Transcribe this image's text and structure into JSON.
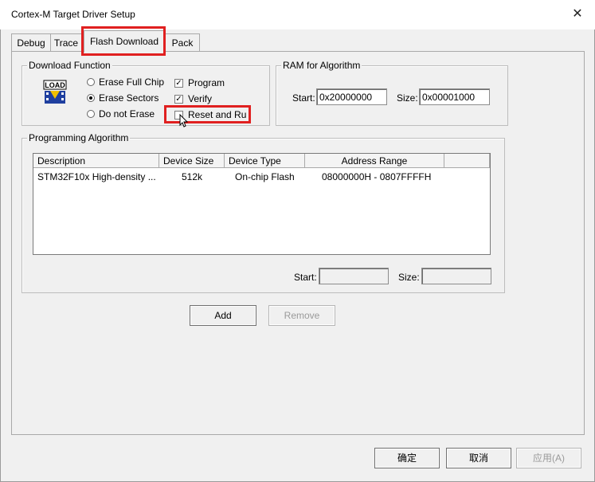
{
  "window": {
    "title": "Cortex-M Target Driver Setup",
    "close_glyph": "✕"
  },
  "tabs": [
    {
      "label": "Debug",
      "active": false
    },
    {
      "label": "Trace",
      "active": false
    },
    {
      "label": "Flash Download",
      "active": true
    },
    {
      "label": "Pack",
      "active": false
    }
  ],
  "download_function": {
    "legend": "Download Function",
    "icon_text": "LOAD",
    "radios": [
      {
        "label": "Erase Full Chip",
        "selected": false
      },
      {
        "label": "Erase Sectors",
        "selected": true
      },
      {
        "label": "Do not Erase",
        "selected": false
      }
    ],
    "checks": [
      {
        "label": "Program",
        "checked": true
      },
      {
        "label": "Verify",
        "checked": true
      },
      {
        "label": "Reset and Run",
        "checked": false
      }
    ]
  },
  "ram": {
    "legend": "RAM for Algorithm",
    "start_label": "Start:",
    "start_value": "0x20000000",
    "size_label": "Size:",
    "size_value": "0x00001000"
  },
  "programming": {
    "legend": "Programming Algorithm",
    "columns": [
      "Description",
      "Device Size",
      "Device Type",
      "Address Range"
    ],
    "rows": [
      {
        "description": "STM32F10x High-density ...",
        "size": "512k",
        "type": "On-chip Flash",
        "range": "08000000H - 0807FFFFH"
      }
    ],
    "start_label": "Start:",
    "start_value": "",
    "size_label": "Size:",
    "size_value": ""
  },
  "buttons": {
    "add": "Add",
    "remove": "Remove",
    "ok": "确定",
    "cancel": "取消",
    "apply": "应用(A)"
  },
  "colors": {
    "highlight": "#e02020",
    "dialog_bg": "#f0f0f0"
  }
}
